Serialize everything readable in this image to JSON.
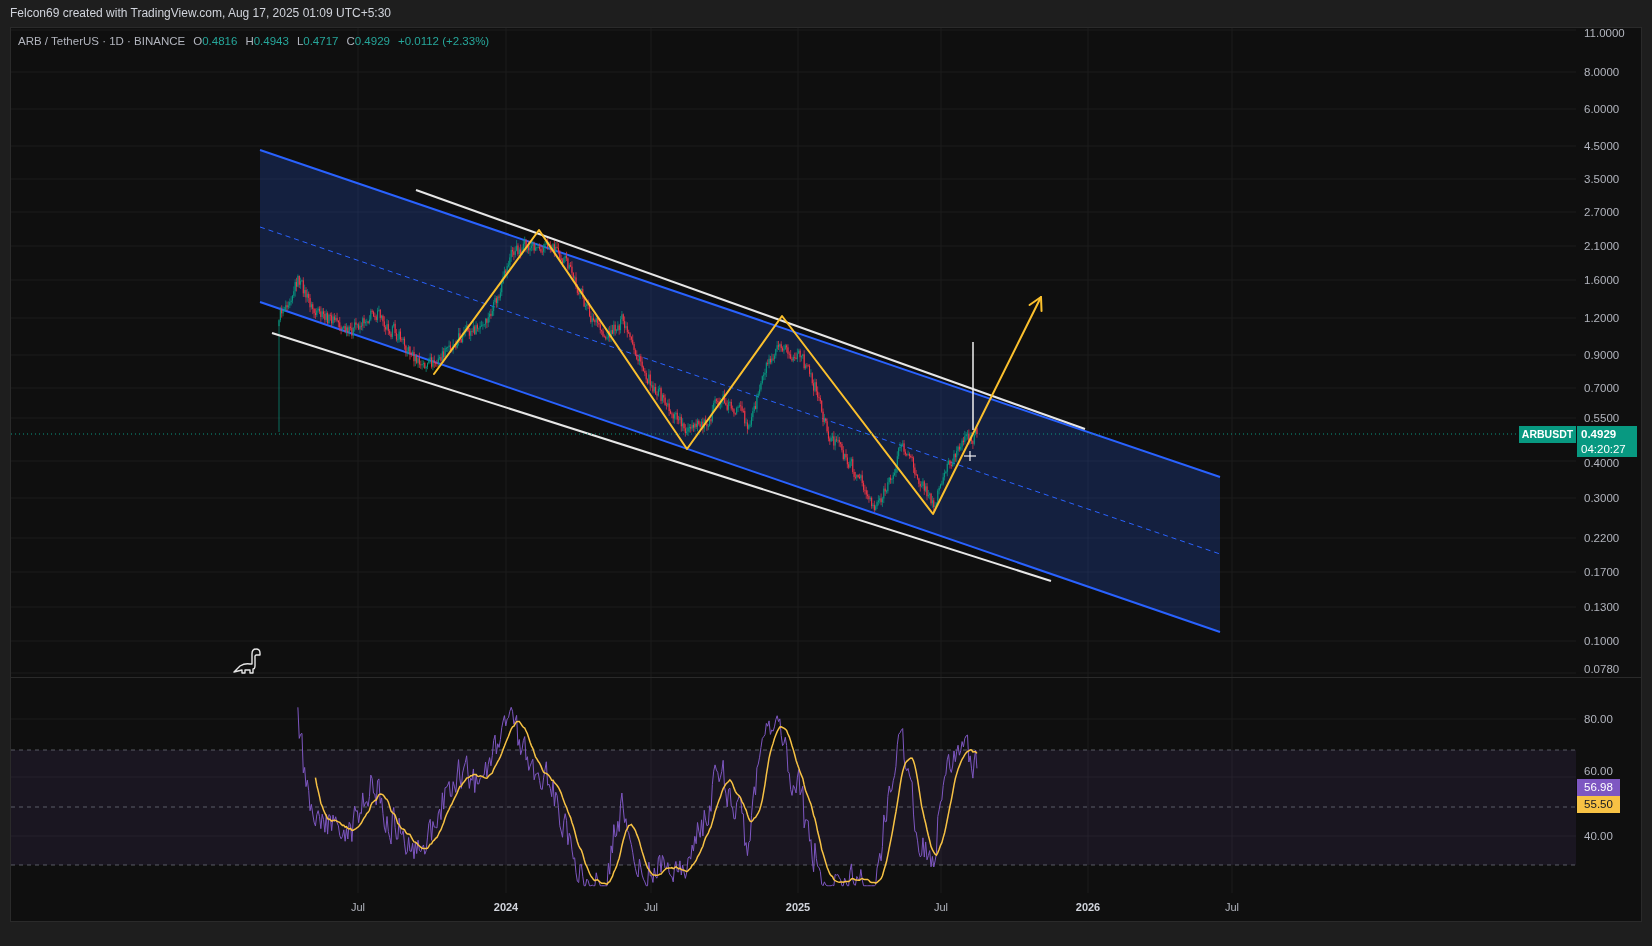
{
  "header": {
    "text": "Felcon69 created with TradingView.com, Aug 17, 2025 01:09 UTC+5:30"
  },
  "legend": {
    "symbol": "ARB / TetherUS · 1D · BINANCE",
    "ohlc": [
      {
        "label": "O",
        "value": "0.4816"
      },
      {
        "label": "H",
        "value": "0.4943"
      },
      {
        "label": "L",
        "value": "0.4717"
      },
      {
        "label": "C",
        "value": "0.4929"
      }
    ],
    "change": "+0.0112 (+2.33%)"
  },
  "price_axis": {
    "labels": [
      "11.0000",
      "8.0000",
      "6.0000",
      "4.5000",
      "3.5000",
      "2.7000",
      "2.1000",
      "1.6000",
      "1.2000",
      "0.9000",
      "0.7000",
      "0.5500",
      "0.4000",
      "0.3000",
      "0.2200",
      "0.1700",
      "0.1300",
      "0.1000",
      "0.0780"
    ],
    "symbol_badge": "ARBUSDT",
    "price_badge": {
      "price": "0.4929",
      "countdown": "04:20:27"
    }
  },
  "rsi_axis": {
    "labels": [
      "80.00",
      "60.00",
      "40.00"
    ],
    "badges": [
      {
        "value": "56.98",
        "color": "#7e57c2"
      },
      {
        "value": "55.50",
        "color": "#f7c244"
      }
    ]
  },
  "time_axis": {
    "labels": [
      {
        "text": "Jul",
        "kind": "month"
      },
      {
        "text": "2024",
        "kind": "year"
      },
      {
        "text": "Jul",
        "kind": "month"
      },
      {
        "text": "2025",
        "kind": "year"
      },
      {
        "text": "Jul",
        "kind": "month"
      },
      {
        "text": "2026",
        "kind": "year"
      },
      {
        "text": "Jul",
        "kind": "month"
      }
    ]
  }
}
